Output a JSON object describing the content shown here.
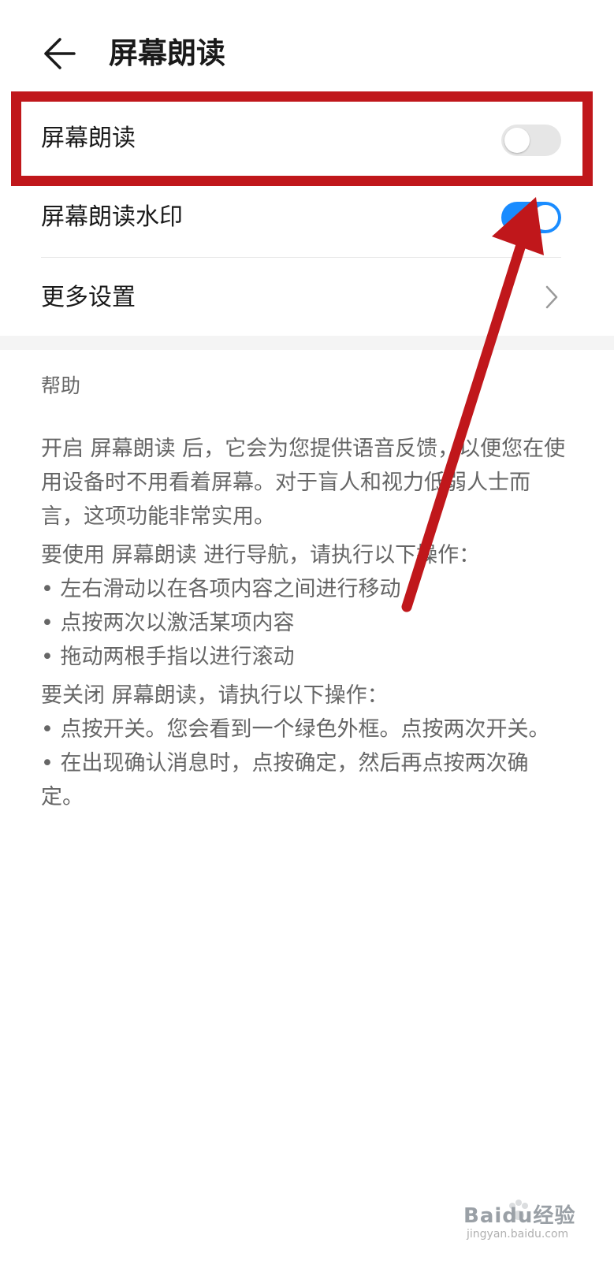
{
  "header": {
    "title": "屏幕朗读",
    "back_icon": "arrow-left-icon"
  },
  "settings": [
    {
      "label": "屏幕朗读",
      "type": "toggle",
      "state": "off"
    },
    {
      "label": "屏幕朗读水印",
      "type": "toggle",
      "state": "on"
    },
    {
      "label": "更多设置",
      "type": "link",
      "icon": "chevron-right-icon"
    }
  ],
  "help": {
    "title": "帮助",
    "lines": [
      "开启 屏幕朗读 后，它会为您提供语音反馈，以便您在使用设备时不用看着屏幕。对于盲人和视力低弱人士而言，这项功能非常实用。",
      "要使用 屏幕朗读 进行导航，请执行以下操作：",
      "• 左右滑动以在各项内容之间进行移动",
      "• 点按两次以激活某项内容",
      "• 拖动两根手指以进行滚动",
      "要关闭 屏幕朗读，请执行以下操作：",
      "• 点按开关。您会看到一个绿色外框。点按两次开关。",
      "• 在出现确认消息时，点按确定，然后再点按两次确定。"
    ]
  },
  "watermark": {
    "text": "Baidu经验",
    "sub": "jingyan.baidu.com"
  },
  "colors": {
    "toggle_on": "#1a8cff",
    "toggle_off": "#e6e6e6",
    "annotation": "#c0171b"
  }
}
